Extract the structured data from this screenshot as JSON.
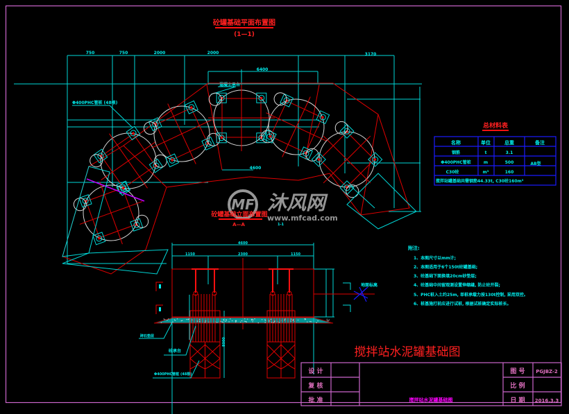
{
  "drawing": {
    "main_title": "搅拌站水泥罐基础图",
    "plan_view": {
      "title": "砼罐基础平面布置图",
      "subtitle": "(1—1)"
    },
    "section_view": {
      "title": "砼罐基础立面布置图",
      "subtitle": "A—A",
      "cut_label": "1-1"
    },
    "plan_dims_top": [
      "750",
      "750",
      "2000",
      "2000"
    ],
    "plan_dim_top_right": "3170",
    "plan_dim_center_top": "6400",
    "plan_dim_center_bottom": "4600",
    "plan_labels": {
      "pile_note": "Φ400PHC管桩 (48根)",
      "cap_note": "混凝土承台"
    },
    "section_dims_top": {
      "total": "4600",
      "left": "1150",
      "middle": "2300",
      "right": "1150"
    },
    "section_labels": {
      "gravel_layer": "碎石垫层",
      "cap_label": "砼承台",
      "pile_label": "Φ400PHC管桩 (48根)",
      "ground_label": "地面标高",
      "depth_label": "8000"
    }
  },
  "material_table": {
    "title": "总材料表",
    "headers": [
      "名称",
      "单位",
      "总重",
      "备注"
    ],
    "rows": [
      [
        "钢筋",
        "t",
        "3.1",
        ""
      ],
      [
        "Φ400PHC管桩",
        "m",
        "500",
        "AB型"
      ],
      [
        "C30砼",
        "m³",
        "160",
        ""
      ]
    ],
    "summary": "搅拌站罐基础共需钢筋44.33t, C30砼160m³"
  },
  "notes": {
    "heading": "附注:",
    "items": [
      "1、本图尺寸以mm计;",
      "2、本图适用于6个150t砼罐基础;",
      "3、砼基础下面换填20cm砂垫层;",
      "4、砼基础中间留观测设置伸缩缝, 防止砼开裂;",
      "5、PHC桩入土约25m, 单桩承载力按130t控制, 采用双控。",
      "6、桩基施打前应进行试桩, 根据试桩确定实际桩长。"
    ]
  },
  "title_block": {
    "design_label": "设 计",
    "design_value": "",
    "review_label": "复 核",
    "review_value": "",
    "approve_label": "批 准",
    "approve_value": "",
    "drawing_name": "搅拌站水泥罐基础图",
    "drawing_no_label": "图 号",
    "drawing_no": "PGJBZ-2",
    "scale_label": "比 例",
    "scale": "",
    "date_label": "日 期",
    "date": "2016.3.3"
  },
  "watermark": {
    "brand": "沐风网",
    "url": "www.mfcad.com",
    "logo": "MF"
  },
  "colors": {
    "background": "#000000",
    "dimension": "#00d8d8",
    "structure": "#e00000",
    "tank_outline": "#d8d8d8",
    "frame": "#cc66cc",
    "table_border": "#1a1aff",
    "title_text": "#ff2020"
  }
}
